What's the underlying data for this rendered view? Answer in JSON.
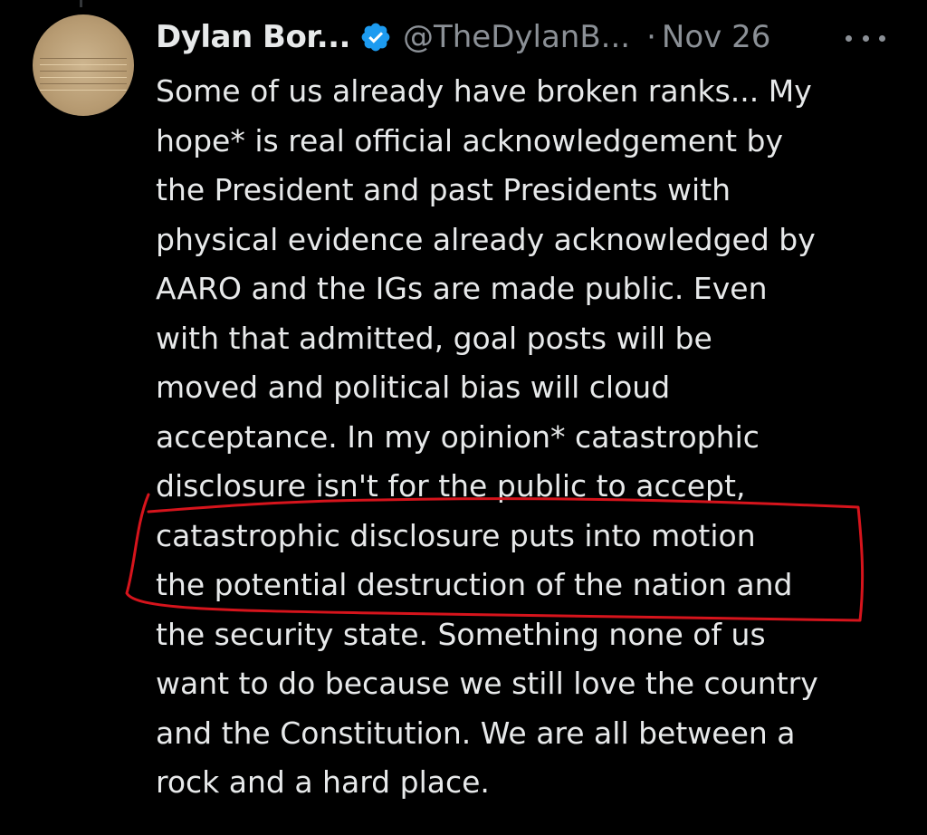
{
  "tweet": {
    "author_name": "Dylan Bor...",
    "handle": "@TheDylanB...",
    "separator": "·",
    "date": "Nov 26",
    "verified_icon": "verified-badge-icon",
    "more_icon": "more-options-icon",
    "accent_color": "#1d9bf0",
    "body_lines": [
      "Some of us already have broken ranks... My",
      "hope* is real official acknowledgement by",
      "the President and past Presidents with",
      "physical evidence already acknowledged by",
      "AARO and the IGs are made public. Even",
      "with that admitted, goal posts will be",
      "moved and political bias will cloud",
      "acceptance. In my opinion* catastrophic",
      "disclosure isn't for the public to accept,",
      "catastrophic disclosure puts into motion",
      "the potential destruction of the nation and",
      "the security state. Something none of us",
      "want to do because we still love the country",
      "and the Constitution. We are all between a",
      "rock and a hard place."
    ]
  },
  "annotation": {
    "color": "#d6141c"
  }
}
